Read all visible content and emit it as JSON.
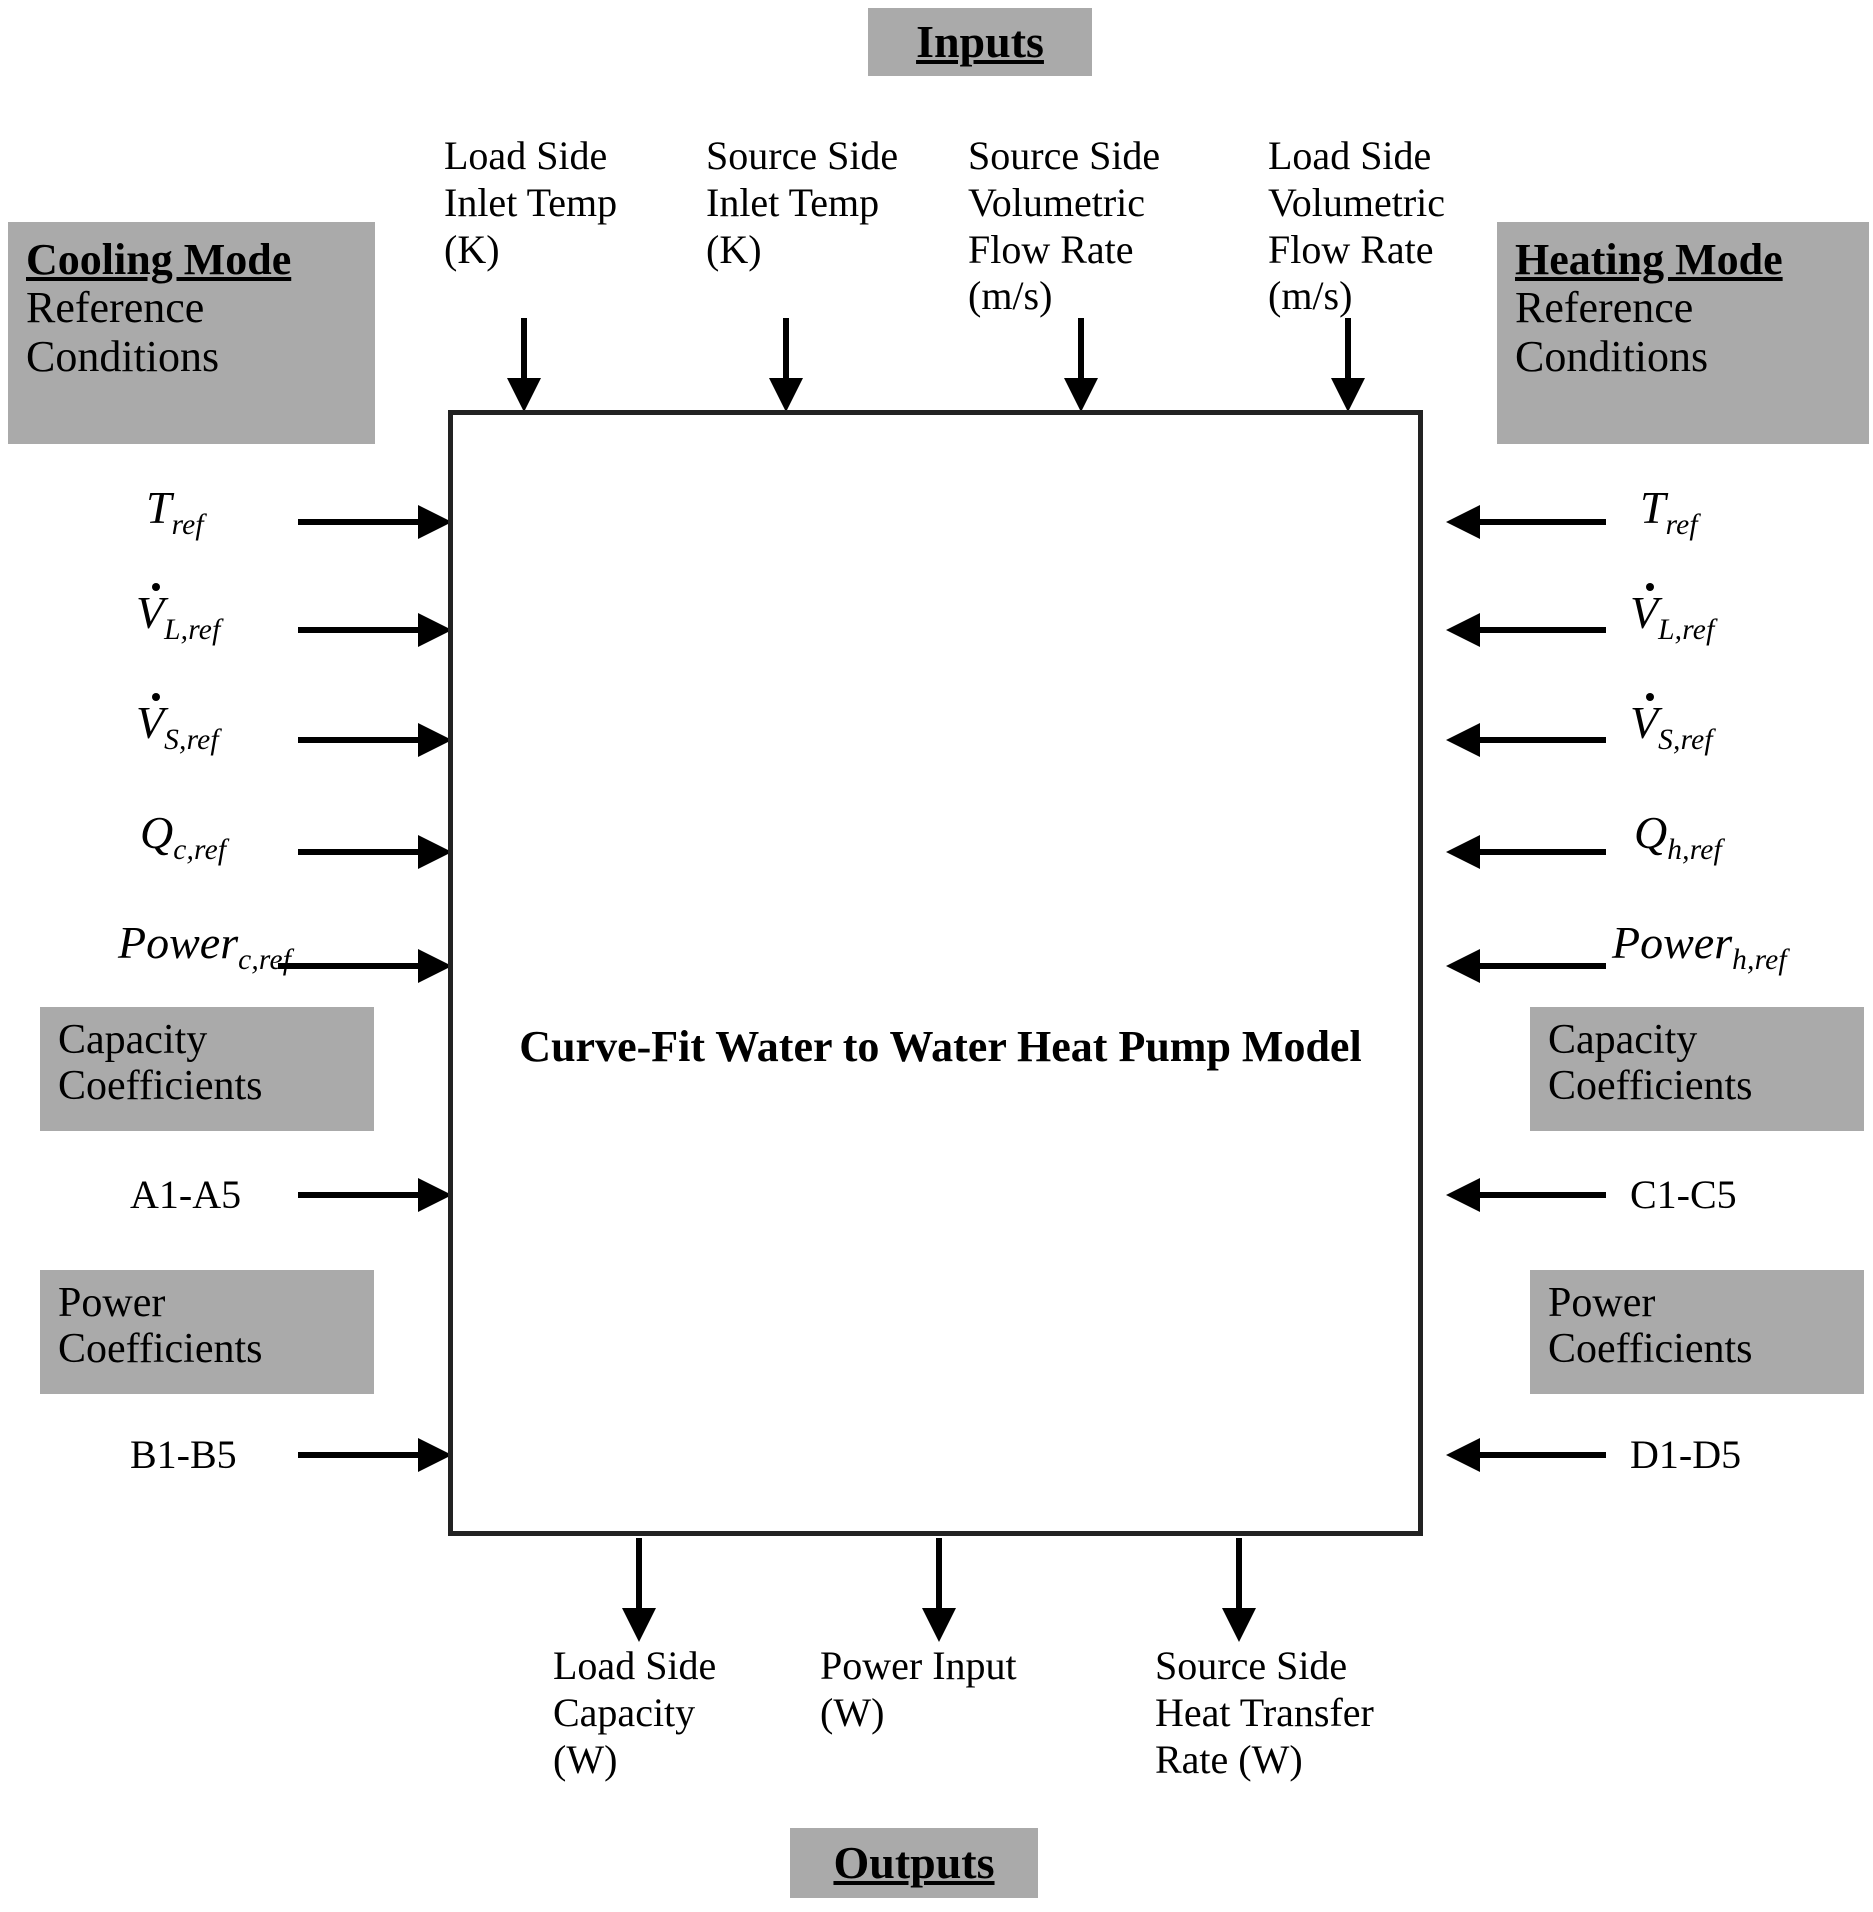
{
  "banners": {
    "inputs": "Inputs",
    "outputs": "Outputs"
  },
  "model": {
    "title": "Curve-Fit Water to Water Heat Pump Model"
  },
  "inputs": [
    {
      "label": "Load Side\nInlet Temp\n(K)"
    },
    {
      "label": "Source Side\nInlet Temp\n(K)"
    },
    {
      "label": "Source Side\nVolumetric\nFlow Rate\n(m/s)"
    },
    {
      "label": "Load Side\nVolumetric\nFlow Rate\n(m/s)"
    }
  ],
  "outputs": [
    {
      "label": "Load Side\nCapacity\n(W)"
    },
    {
      "label": "Power Input\n(W)"
    },
    {
      "label": "Source Side\nHeat Transfer\nRate (W)"
    }
  ],
  "cooling": {
    "chip_header": "Cooling Mode",
    "chip_sub_1": "Reference",
    "chip_sub_2": "Conditions",
    "symbols": [
      {
        "base": "T",
        "sub": "ref",
        "dot": false
      },
      {
        "base": "V",
        "sub": "L,ref",
        "dot": true
      },
      {
        "base": "V",
        "sub": "S,ref",
        "dot": true
      },
      {
        "base": "Q",
        "sub": "c,ref",
        "dot": false
      },
      {
        "base": "Power",
        "sub": "c,ref",
        "dot": false
      }
    ],
    "capacity_chip_1": "Capacity",
    "capacity_chip_2": "Coefficients",
    "capacity_range": "A1-A5",
    "power_chip_1": "Power",
    "power_chip_2": "Coefficients",
    "power_range": "B1-B5"
  },
  "heating": {
    "chip_header": "Heating Mode",
    "chip_sub_1": "Reference",
    "chip_sub_2": "Conditions",
    "symbols": [
      {
        "base": "T",
        "sub": "ref",
        "dot": false
      },
      {
        "base": "V",
        "sub": "L,ref",
        "dot": true
      },
      {
        "base": "V",
        "sub": "S,ref",
        "dot": true
      },
      {
        "base": "Q",
        "sub": "h,ref",
        "dot": false
      },
      {
        "base": "Power",
        "sub": "h,ref",
        "dot": false
      }
    ],
    "capacity_chip_1": "Capacity",
    "capacity_chip_2": "Coefficients",
    "capacity_range": "C1-C5",
    "power_chip_1": "Power",
    "power_chip_2": "Coefficients",
    "power_range": "D1-D5"
  },
  "colors": {
    "chip_background": "#aaaaaa",
    "line": "#222222",
    "text": "#000000",
    "page": "#ffffff"
  }
}
